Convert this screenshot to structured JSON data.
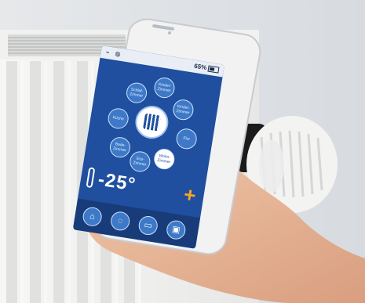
{
  "phone": {
    "status": {
      "battery": "65%"
    },
    "rooms": [
      "Schlaf-\nZimmer",
      "Kinder-\nZimmer",
      "Kinder-\nZimmer",
      "Küche",
      "Flur",
      "Bade-\nZimmer",
      "Ess-\nZimmer",
      "Wohn-\nZimmer"
    ],
    "temperature": "-25°",
    "plus": "+"
  },
  "colors": {
    "screen_blue": "#1f4f9e",
    "bubble_blue": "#3d79c7",
    "accent_orange": "#f4a52a"
  },
  "icons": [
    "wifi-icon",
    "globe-icon",
    "battery-icon",
    "house-icon",
    "bulb-icon",
    "car-icon",
    "lock-icon",
    "thermometer-icon"
  ]
}
